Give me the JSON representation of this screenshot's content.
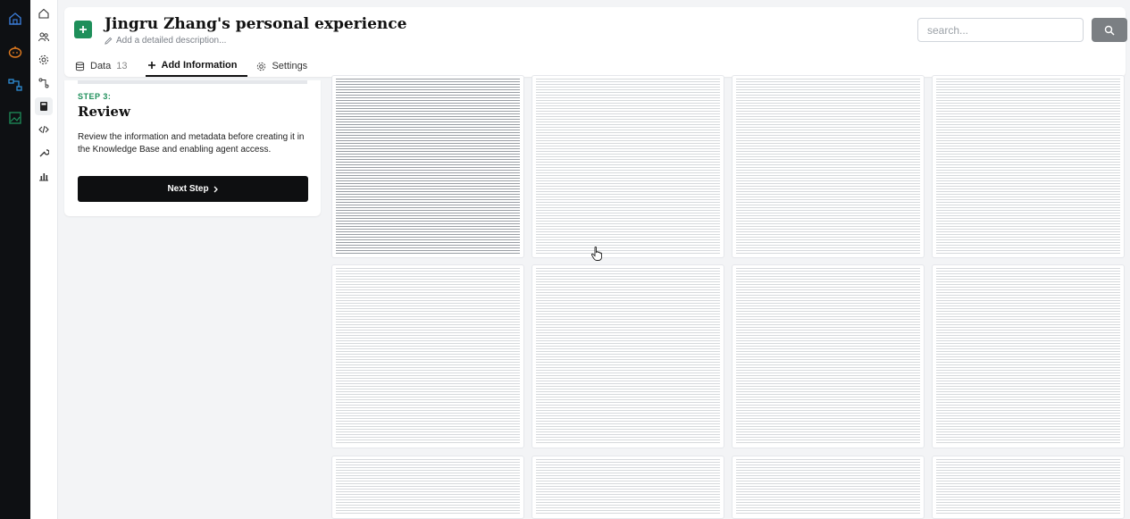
{
  "header": {
    "title": "Jingru Zhang's personal experience",
    "description_placeholder": "Add a detailed description...",
    "search_placeholder": "search..."
  },
  "tabs": [
    {
      "label": "Data",
      "count": "13",
      "icon": "database-icon"
    },
    {
      "label": "Add Information",
      "icon": "plus-icon"
    },
    {
      "label": "Settings",
      "icon": "gear-icon"
    }
  ],
  "active_tab": "Add Information",
  "step": {
    "label": "STEP 3:",
    "title": "Review",
    "text": "Review the information and metadata before creating it in the Knowledge Base and enabling agent access.",
    "next_button": "Next Step"
  },
  "icons": {
    "rail": [
      "home-outline-icon",
      "pumpkin-icon",
      "workflow-icon",
      "image-icon"
    ],
    "nav": [
      "home-icon",
      "users-icon",
      "gear-icon",
      "flow-icon",
      "book-icon",
      "code-icon",
      "wrench-icon",
      "chart-icon"
    ]
  },
  "colors": {
    "rail_bg": "#0e1013",
    "accent_green": "#1e8f5a",
    "pumpkin_orange": "#e07a1f",
    "workflow_blue": "#2f8fd8",
    "button_dark": "#0e0f11",
    "search_button": "#7b7f83"
  }
}
